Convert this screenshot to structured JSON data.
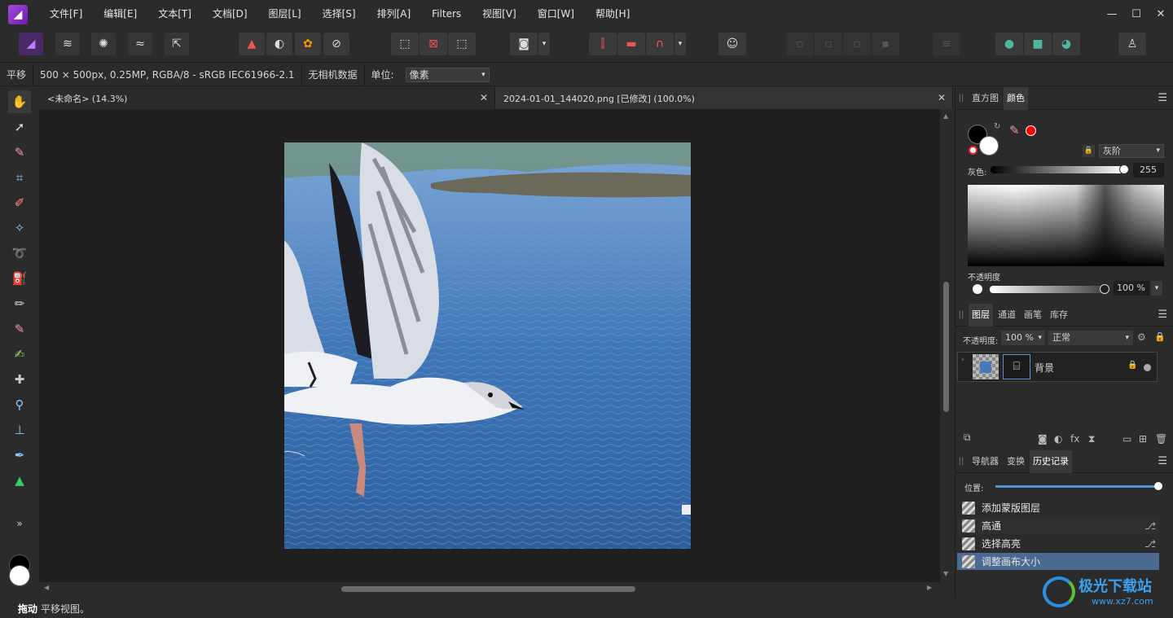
{
  "menu": [
    "文件[F]",
    "编辑[E]",
    "文本[T]",
    "文档[D]",
    "图层[L]",
    "选择[S]",
    "排列[A]",
    "Filters",
    "视图[V]",
    "窗口[W]",
    "帮助[H]"
  ],
  "window_controls": {
    "minimize": "—",
    "maximize": "☐",
    "close": "✕"
  },
  "context": {
    "tool": "平移",
    "doc_info": "500 × 500px, 0.25MP, RGBA/8 - sRGB IEC61966-2.1",
    "camera": "无相机数据",
    "unit_label": "单位:",
    "unit_value": "像素"
  },
  "tabs": [
    {
      "title": "<未命名> (14.3%)"
    },
    {
      "title": "2024-01-01_144020.png [已修改] (100.0%)"
    }
  ],
  "status": {
    "action": "拖动",
    "hint": "平移视图。"
  },
  "panel_color": {
    "tabs": [
      "直方图",
      "颜色"
    ],
    "mode": "灰阶",
    "gray_label": "灰色:",
    "gray_value": "255",
    "opacity_label": "不透明度",
    "opacity_value": "100 %",
    "accent": "#ff0000"
  },
  "panel_layers": {
    "tabs": [
      "图层",
      "通道",
      "画笔",
      "库存"
    ],
    "opacity_label": "不透明度:",
    "opacity_value": "100 %",
    "blend": "正常",
    "layer_name": "背景"
  },
  "panel_history": {
    "tabs": [
      "导航器",
      "变换",
      "历史记录"
    ],
    "position_label": "位置:",
    "items": [
      "添加蒙版图层",
      "高通",
      "选择高亮",
      "调整画布大小"
    ],
    "selected_index": 3
  },
  "watermark": {
    "brand": "极光下载站",
    "url": "www.xz7.com"
  }
}
